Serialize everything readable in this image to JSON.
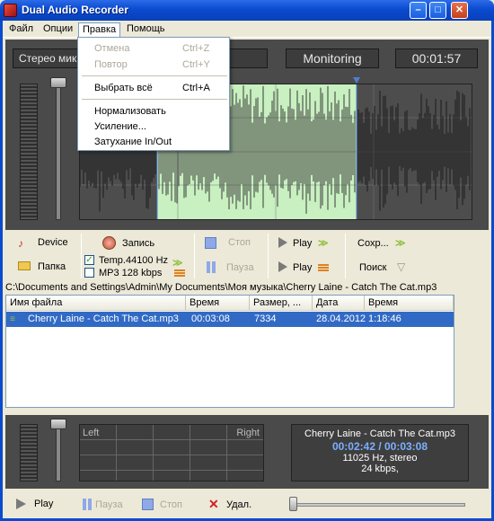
{
  "window": {
    "title": "Dual Audio Recorder"
  },
  "menubar": {
    "items": [
      "Файл",
      "Опции",
      "Правка",
      "Помощь"
    ]
  },
  "edit_menu": {
    "items": [
      {
        "label": "Отмена",
        "shortcut": "Ctrl+Z"
      },
      {
        "label": "Повтор",
        "shortcut": "Ctrl+Y"
      },
      {
        "label": "Выбрать всё",
        "shortcut": "Ctrl+A"
      },
      {
        "label": "Нормализовать",
        "shortcut": ""
      },
      {
        "label": "Усиление...",
        "shortcut": ""
      },
      {
        "label": "Затухание In/Out",
        "shortcut": ""
      }
    ]
  },
  "top_panel": {
    "source": "Стерео мик",
    "status": "Monitoring",
    "timer": "00:01:57"
  },
  "toolbar": {
    "device": "Device",
    "folder": "Папка",
    "record": "Запись",
    "temp_format": "Temp.44100 Hz",
    "mp3_format": "MP3 128 kbps",
    "temp_checked": true,
    "mp3_checked": false,
    "stop": "Стоп",
    "pause": "Пауза",
    "play1": "Play",
    "play2": "Play",
    "save": "Сохр...",
    "search": "Поиск"
  },
  "path": "C:\\Documents and Settings\\Admin\\My Documents\\Моя музыка\\Cherry Laine - Catch The Cat.mp3",
  "file_list": {
    "columns": [
      "Имя файла",
      "Время",
      "Размер, ...",
      "Дата",
      "Время"
    ],
    "rows": [
      {
        "name": "Cherry Laine - Catch The Cat.mp3",
        "duration": "00:03:08",
        "size": "7334",
        "date": "28.04.2012",
        "time": "1:18:46"
      }
    ]
  },
  "meter": {
    "left": "Left",
    "right": "Right"
  },
  "now_playing": {
    "title": "Cherry Laine - Catch The Cat.mp3",
    "progress": "00:02:42 / 00:03:08",
    "format": "11025 Hz, stereo",
    "bitrate": "24 kbps,"
  },
  "player": {
    "play": "Play",
    "pause": "Пауза",
    "stop": "Стоп",
    "delete": "Удал."
  },
  "colors": {
    "accent": "#316AC5",
    "titlebar": "#0A4BD0",
    "waveform": "#c8f0c0"
  }
}
